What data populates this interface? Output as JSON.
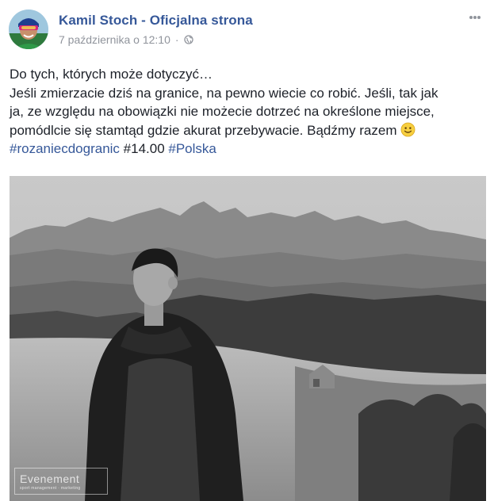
{
  "post": {
    "page_name": "Kamil Stoch - Oficjalna strona",
    "date": "7 października o 12:10",
    "privacy_icon": "globe-icon",
    "more_icon": "more-options-icon",
    "text_lines": [
      "Do tych, których może dotyczyć…",
      "Jeśli zmierzacie dziś na granice, na pewno wiecie co robić. Jeśli, tak jak",
      "ja, ze względu na obowiązki nie możecie dotrzeć na określone miejsce,",
      "pomódlcie się stamtąd gdzie akurat przebywacie. Bądźmy razem"
    ],
    "emoji": "smile-emoji-icon",
    "hashtags": {
      "first": "#rozaniecdogranic",
      "middle": "#14.00",
      "last": "#Polska"
    },
    "photo": {
      "alt_icon": "mountain-photo",
      "watermark_main": "Evenement",
      "watermark_sub": "sport management · marketing"
    }
  },
  "colors": {
    "link": "#365899",
    "text": "#1d2129",
    "meta": "#90949c"
  }
}
